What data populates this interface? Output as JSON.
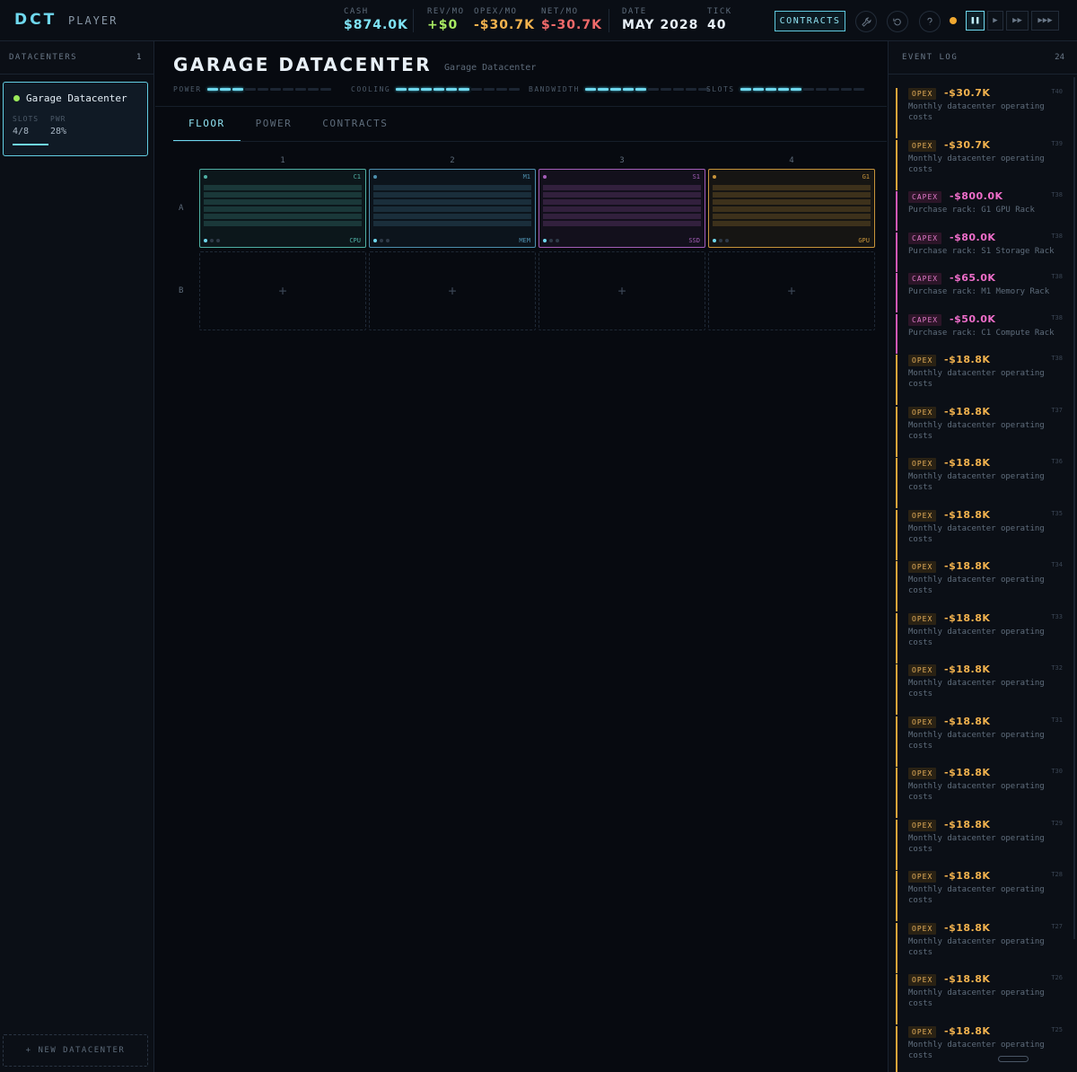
{
  "topbar": {
    "logo": "DCT",
    "player": "PLAYER",
    "stats": [
      {
        "label": "CASH",
        "value": "$874.0K",
        "color": "#7fe3f4"
      },
      {
        "label": "REV/MO",
        "value": "+$0",
        "color": "#a8ea62"
      },
      {
        "label": "OPEX/MO",
        "value": "-$30.7K",
        "color": "#f2b24e"
      },
      {
        "label": "NET/MO",
        "value": "$-30.7K",
        "color": "#f06a6a"
      },
      {
        "label": "DATE",
        "value": "MAY 2028",
        "color": "#e8f0f7"
      },
      {
        "label": "TICK",
        "value": "40",
        "color": "#e8f0f7"
      }
    ],
    "contracts_label": "CONTRACTS",
    "icons": {
      "tool": "wrench-icon",
      "reset": "reset-icon",
      "help": "help-icon",
      "status": "status-dot-icon"
    },
    "speed": {
      "pause": "❚❚",
      "play": "▶",
      "fast": "▶▶",
      "fastest": "▶▶▶"
    }
  },
  "sidebar": {
    "heading": "DATACENTERS",
    "count": "1",
    "datacenters": [
      {
        "name": "Garage Datacenter",
        "slots_label": "SLOTS",
        "slots_value": "4/8",
        "pwr_label": "PWR",
        "pwr_value": "28%"
      }
    ],
    "new_button": "+ NEW DATACENTER"
  },
  "main": {
    "title": "GARAGE DATACENTER",
    "subtitle": "Garage Datacenter",
    "meters": [
      {
        "label": "POWER",
        "level": 3,
        "total": 10
      },
      {
        "label": "COOLING",
        "level": 6,
        "total": 10
      },
      {
        "label": "BANDWIDTH",
        "level": 5,
        "total": 10
      },
      {
        "label": "SLOTS",
        "level": 5,
        "total": 10
      }
    ],
    "tabs": [
      "FLOOR",
      "POWER",
      "CONTRACTS"
    ],
    "active_tab": "FLOOR",
    "columns": [
      "1",
      "2",
      "3",
      "4"
    ],
    "rows": [
      "A",
      "B"
    ],
    "racks": [
      {
        "code": "C1",
        "kind": "CPU",
        "color": "#4fb0a4"
      },
      {
        "code": "M1",
        "kind": "MEM",
        "color": "#4d8fae"
      },
      {
        "code": "S1",
        "kind": "SSD",
        "color": "#a45db8"
      },
      {
        "code": "G1",
        "kind": "GPU",
        "color": "#c8943a"
      }
    ],
    "empty_slot": "+"
  },
  "event_log": {
    "heading": "EVENT LOG",
    "count": "24",
    "events": [
      {
        "tag": "OPEX",
        "amount": "-$30.7K",
        "tick": "T40",
        "desc": "Monthly datacenter operating costs"
      },
      {
        "tag": "OPEX",
        "amount": "-$30.7K",
        "tick": "T39",
        "desc": "Monthly datacenter operating costs"
      },
      {
        "tag": "CAPEX",
        "amount": "-$800.0K",
        "tick": "T38",
        "desc": "Purchase rack: G1 GPU Rack"
      },
      {
        "tag": "CAPEX",
        "amount": "-$80.0K",
        "tick": "T38",
        "desc": "Purchase rack: S1 Storage Rack"
      },
      {
        "tag": "CAPEX",
        "amount": "-$65.0K",
        "tick": "T38",
        "desc": "Purchase rack: M1 Memory Rack"
      },
      {
        "tag": "CAPEX",
        "amount": "-$50.0K",
        "tick": "T38",
        "desc": "Purchase rack: C1 Compute Rack"
      },
      {
        "tag": "OPEX",
        "amount": "-$18.8K",
        "tick": "T38",
        "desc": "Monthly datacenter operating costs"
      },
      {
        "tag": "OPEX",
        "amount": "-$18.8K",
        "tick": "T37",
        "desc": "Monthly datacenter operating costs"
      },
      {
        "tag": "OPEX",
        "amount": "-$18.8K",
        "tick": "T36",
        "desc": "Monthly datacenter operating costs"
      },
      {
        "tag": "OPEX",
        "amount": "-$18.8K",
        "tick": "T35",
        "desc": "Monthly datacenter operating costs"
      },
      {
        "tag": "OPEX",
        "amount": "-$18.8K",
        "tick": "T34",
        "desc": "Monthly datacenter operating costs"
      },
      {
        "tag": "OPEX",
        "amount": "-$18.8K",
        "tick": "T33",
        "desc": "Monthly datacenter operating costs"
      },
      {
        "tag": "OPEX",
        "amount": "-$18.8K",
        "tick": "T32",
        "desc": "Monthly datacenter operating costs"
      },
      {
        "tag": "OPEX",
        "amount": "-$18.8K",
        "tick": "T31",
        "desc": "Monthly datacenter operating costs"
      },
      {
        "tag": "OPEX",
        "amount": "-$18.8K",
        "tick": "T30",
        "desc": "Monthly datacenter operating costs"
      },
      {
        "tag": "OPEX",
        "amount": "-$18.8K",
        "tick": "T29",
        "desc": "Monthly datacenter operating costs"
      },
      {
        "tag": "OPEX",
        "amount": "-$18.8K",
        "tick": "T28",
        "desc": "Monthly datacenter operating costs"
      },
      {
        "tag": "OPEX",
        "amount": "-$18.8K",
        "tick": "T27",
        "desc": "Monthly datacenter operating costs"
      },
      {
        "tag": "OPEX",
        "amount": "-$18.8K",
        "tick": "T26",
        "desc": "Monthly datacenter operating costs"
      },
      {
        "tag": "OPEX",
        "amount": "-$18.8K",
        "tick": "T25",
        "desc": "Monthly datacenter operating costs"
      }
    ]
  }
}
